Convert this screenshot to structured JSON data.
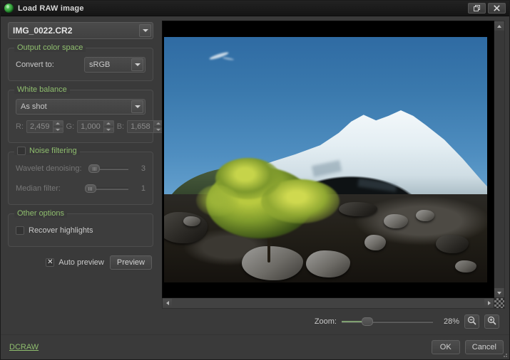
{
  "window": {
    "title": "Load RAW image",
    "icon": "app-icon",
    "buttons": [
      {
        "name": "maximize",
        "icon": "maximize-icon"
      },
      {
        "name": "close",
        "icon": "close-icon"
      }
    ]
  },
  "file_combo": {
    "value": "IMG_0022.CR2",
    "arrow_icon": "chevron-down-icon"
  },
  "output_color_space": {
    "title": "Output color space",
    "convert_label": "Convert to:",
    "convert_value": "sRGB"
  },
  "white_balance": {
    "title": "White balance",
    "mode_value": "As shot",
    "channels": [
      {
        "label": "R:",
        "value": "2,459"
      },
      {
        "label": "G:",
        "value": "1,000"
      },
      {
        "label": "B:",
        "value": "1,658"
      }
    ]
  },
  "noise_filtering": {
    "title": "Noise filtering",
    "enabled": false,
    "sliders": [
      {
        "label": "Wavelet denoising:",
        "value": "3",
        "pos_pct": 12
      },
      {
        "label": "Median filter:",
        "value": "1",
        "pos_pct": 1
      }
    ]
  },
  "other_options": {
    "title": "Other options",
    "recover_highlights_label": "Recover highlights",
    "recover_highlights_checked": false
  },
  "preview_controls": {
    "auto_preview_label": "Auto preview",
    "auto_preview_checked": true,
    "preview_button": "Preview"
  },
  "zoom_controls": {
    "label": "Zoom:",
    "percent": "28%",
    "slider_pos_pct": 28,
    "zoom_out_icon": "zoom-out-icon",
    "zoom_in_icon": "zoom-in-icon"
  },
  "image_preview": {
    "alt": "Snow-capped volcano above a rocky volcanic field with a sunlit shrub",
    "vscroll_up_icon": "scroll-up-icon",
    "vscroll_down_icon": "scroll-down-icon",
    "hscroll_left_icon": "scroll-left-icon",
    "hscroll_right_icon": "scroll-right-icon"
  },
  "footer": {
    "link": "DCRAW",
    "ok_button": "OK",
    "cancel_button": "Cancel"
  },
  "colors": {
    "accent_green": "#8fbe6e",
    "panel_bg": "#3a3a3a",
    "titlebar_bg": "#1a1a1a",
    "text": "#c8c8c8"
  }
}
